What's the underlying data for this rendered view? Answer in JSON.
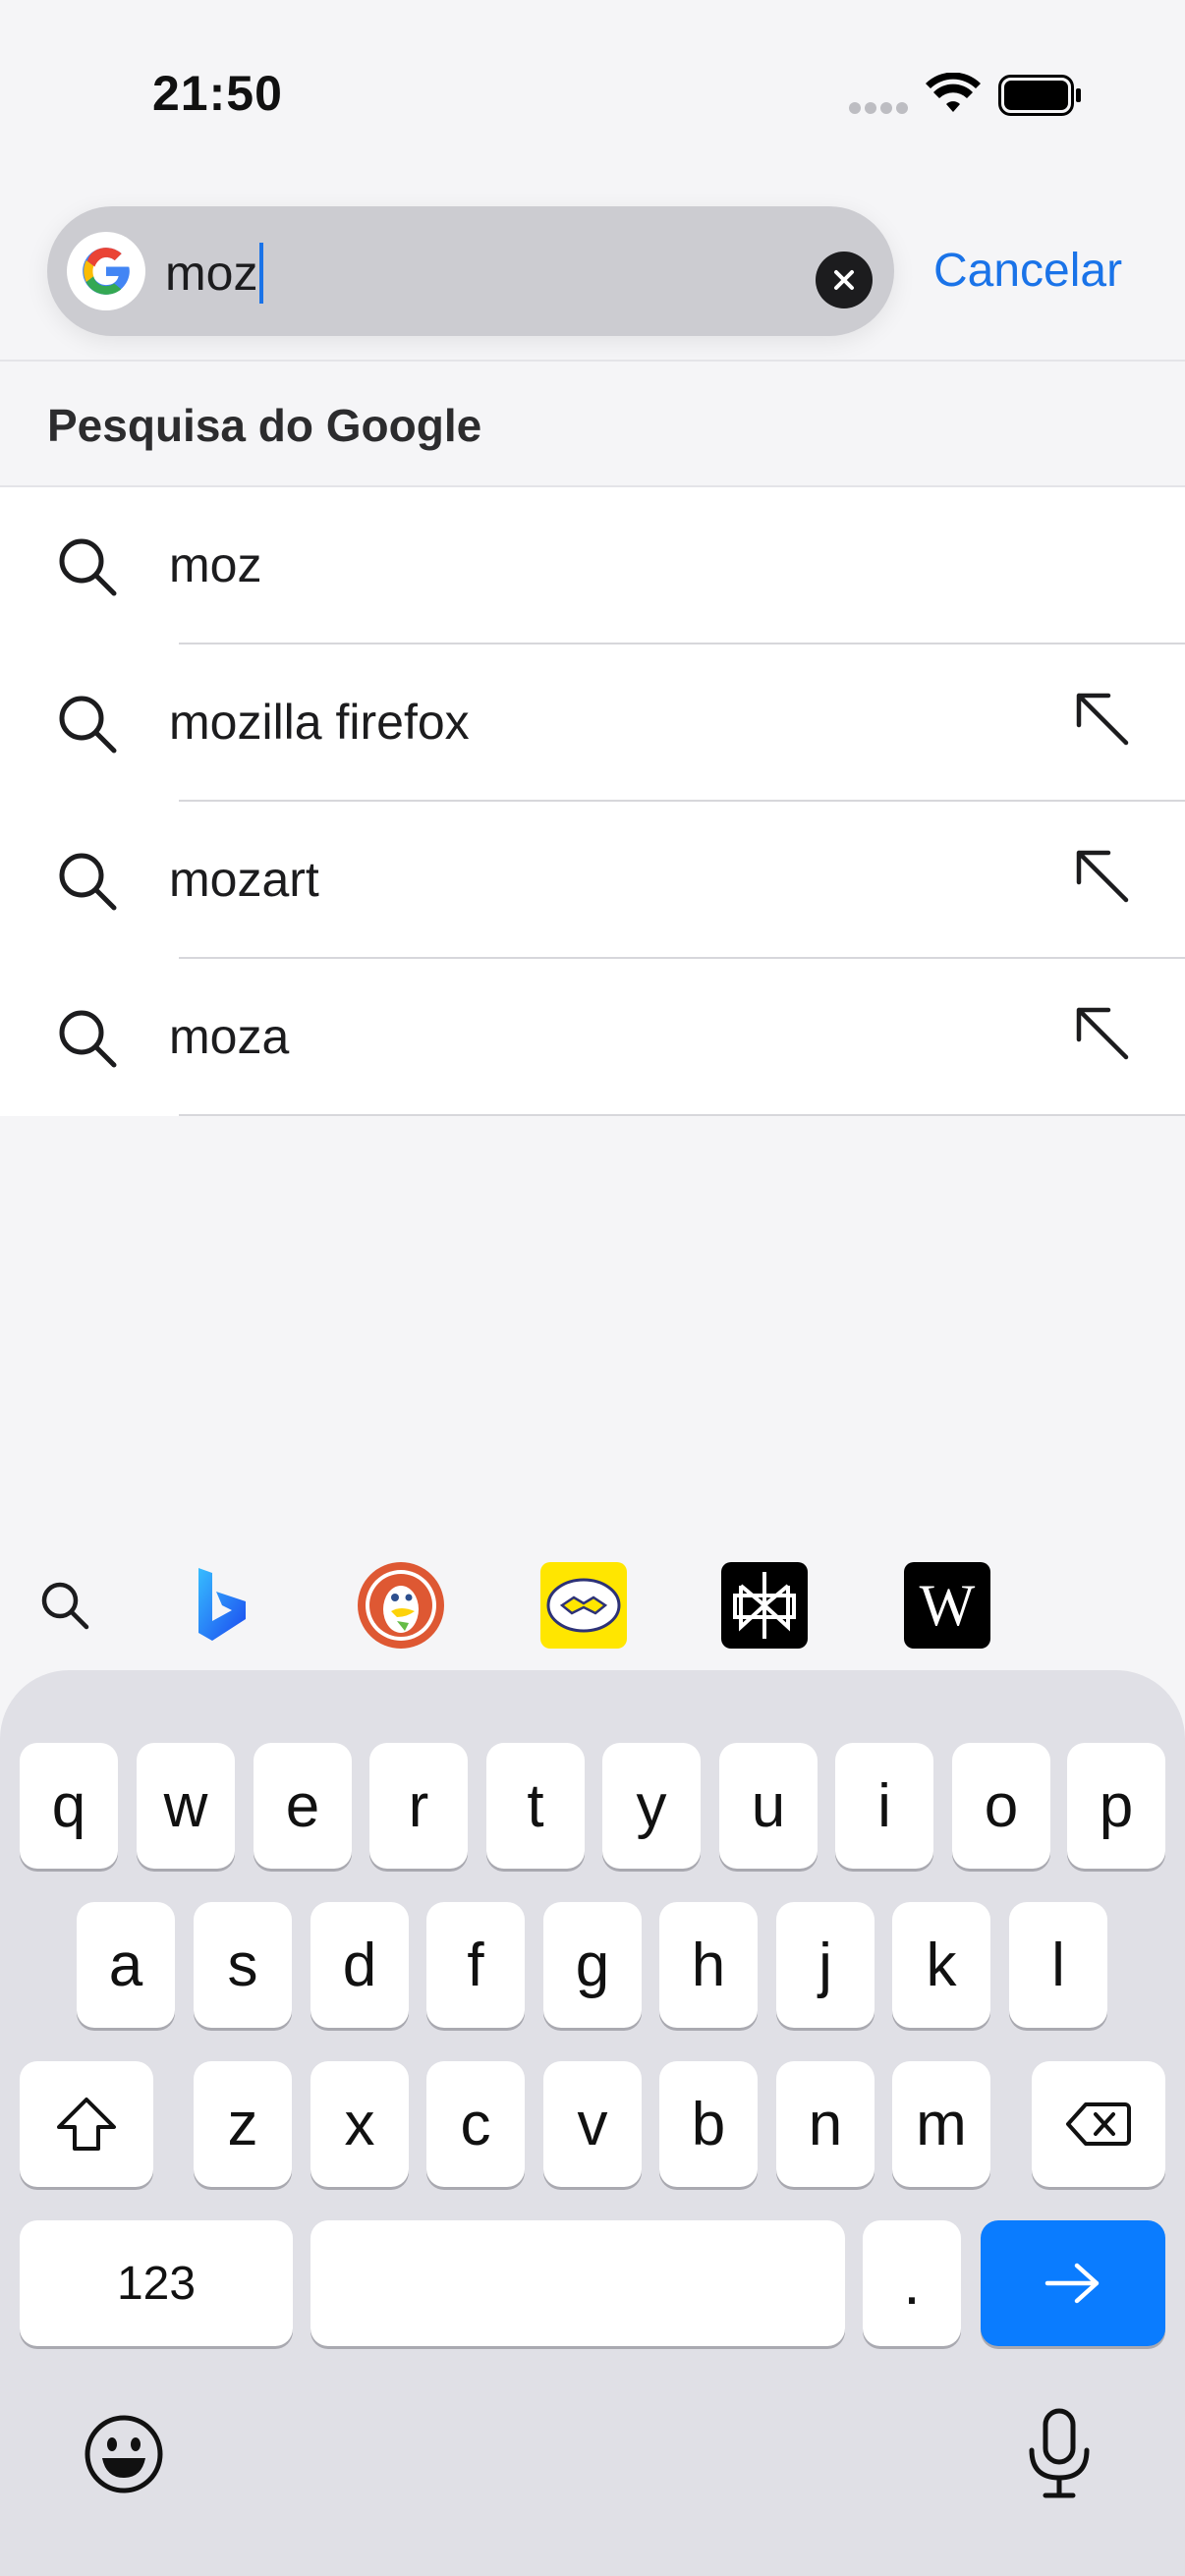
{
  "status_bar": {
    "time": "21:50"
  },
  "search": {
    "query": "moz",
    "cancel_label": "Cancelar"
  },
  "section": {
    "title": "Pesquisa do Google"
  },
  "suggestions": [
    {
      "text": "moz",
      "has_fill_arrow": false
    },
    {
      "text": "mozilla firefox",
      "has_fill_arrow": true
    },
    {
      "text": "mozart",
      "has_fill_arrow": true
    },
    {
      "text": "moza",
      "has_fill_arrow": true
    }
  ],
  "engines": [
    {
      "name": "search-icon"
    },
    {
      "name": "bing-icon",
      "color": "#1a73e8"
    },
    {
      "name": "duckduckgo-icon",
      "color": "#de5833"
    },
    {
      "name": "mercadolivre-icon",
      "color": "#ffe600"
    },
    {
      "name": "perplexity-icon",
      "color": "#000000"
    },
    {
      "name": "wikipedia-icon",
      "color": "#000000",
      "letter": "W"
    }
  ],
  "keyboard": {
    "row1": [
      "q",
      "w",
      "e",
      "r",
      "t",
      "y",
      "u",
      "i",
      "o",
      "p"
    ],
    "row2": [
      "a",
      "s",
      "d",
      "f",
      "g",
      "h",
      "j",
      "k",
      "l"
    ],
    "row3": [
      "z",
      "x",
      "c",
      "v",
      "b",
      "n",
      "m"
    ],
    "numbers_label": "123",
    "period_label": "."
  },
  "colors": {
    "accent": "#1a73e8",
    "go_key": "#0a7cff"
  }
}
